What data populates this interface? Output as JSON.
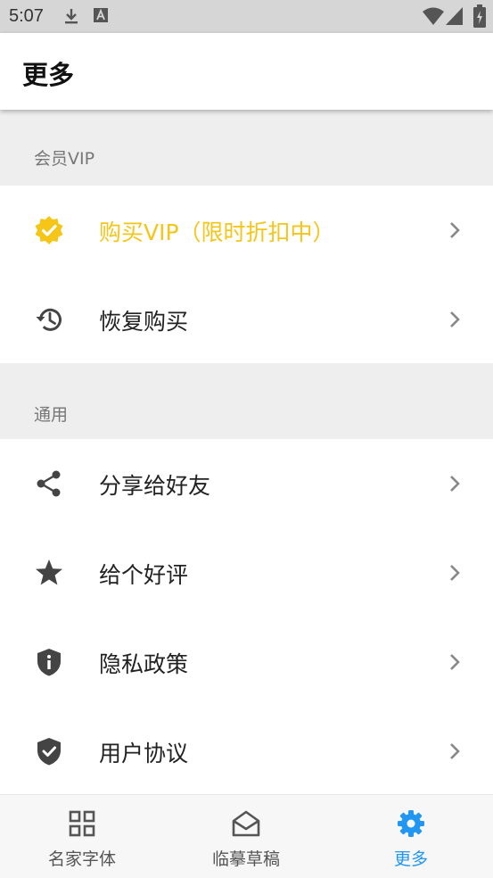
{
  "status_bar": {
    "time": "5:07",
    "icons": [
      "download-icon",
      "text-a-icon",
      "wifi-icon",
      "signal-icon",
      "battery-icon"
    ]
  },
  "app_bar": {
    "title": "更多"
  },
  "sections": [
    {
      "header": "会员VIP",
      "items": [
        {
          "label": "购买VIP（限时折扣中）",
          "icon": "verified-badge-icon",
          "highlight": true
        },
        {
          "label": "恢复购买",
          "icon": "history-icon"
        }
      ]
    },
    {
      "header": "通用",
      "items": [
        {
          "label": "分享给好友",
          "icon": "share-icon"
        },
        {
          "label": "给个好评",
          "icon": "star-icon"
        },
        {
          "label": "隐私政策",
          "icon": "info-shield-icon"
        },
        {
          "label": "用户协议",
          "icon": "check-shield-icon"
        }
      ]
    }
  ],
  "bottom_nav": [
    {
      "label": "名家字体",
      "icon": "grid-icon",
      "active": false
    },
    {
      "label": "临摹草稿",
      "icon": "mail-open-icon",
      "active": false
    },
    {
      "label": "更多",
      "icon": "gear-icon",
      "active": true
    }
  ],
  "colors": {
    "accent_vip": "#f5c518",
    "nav_active": "#2196f3",
    "icon_gray": "#444444",
    "chevron": "#888888"
  }
}
